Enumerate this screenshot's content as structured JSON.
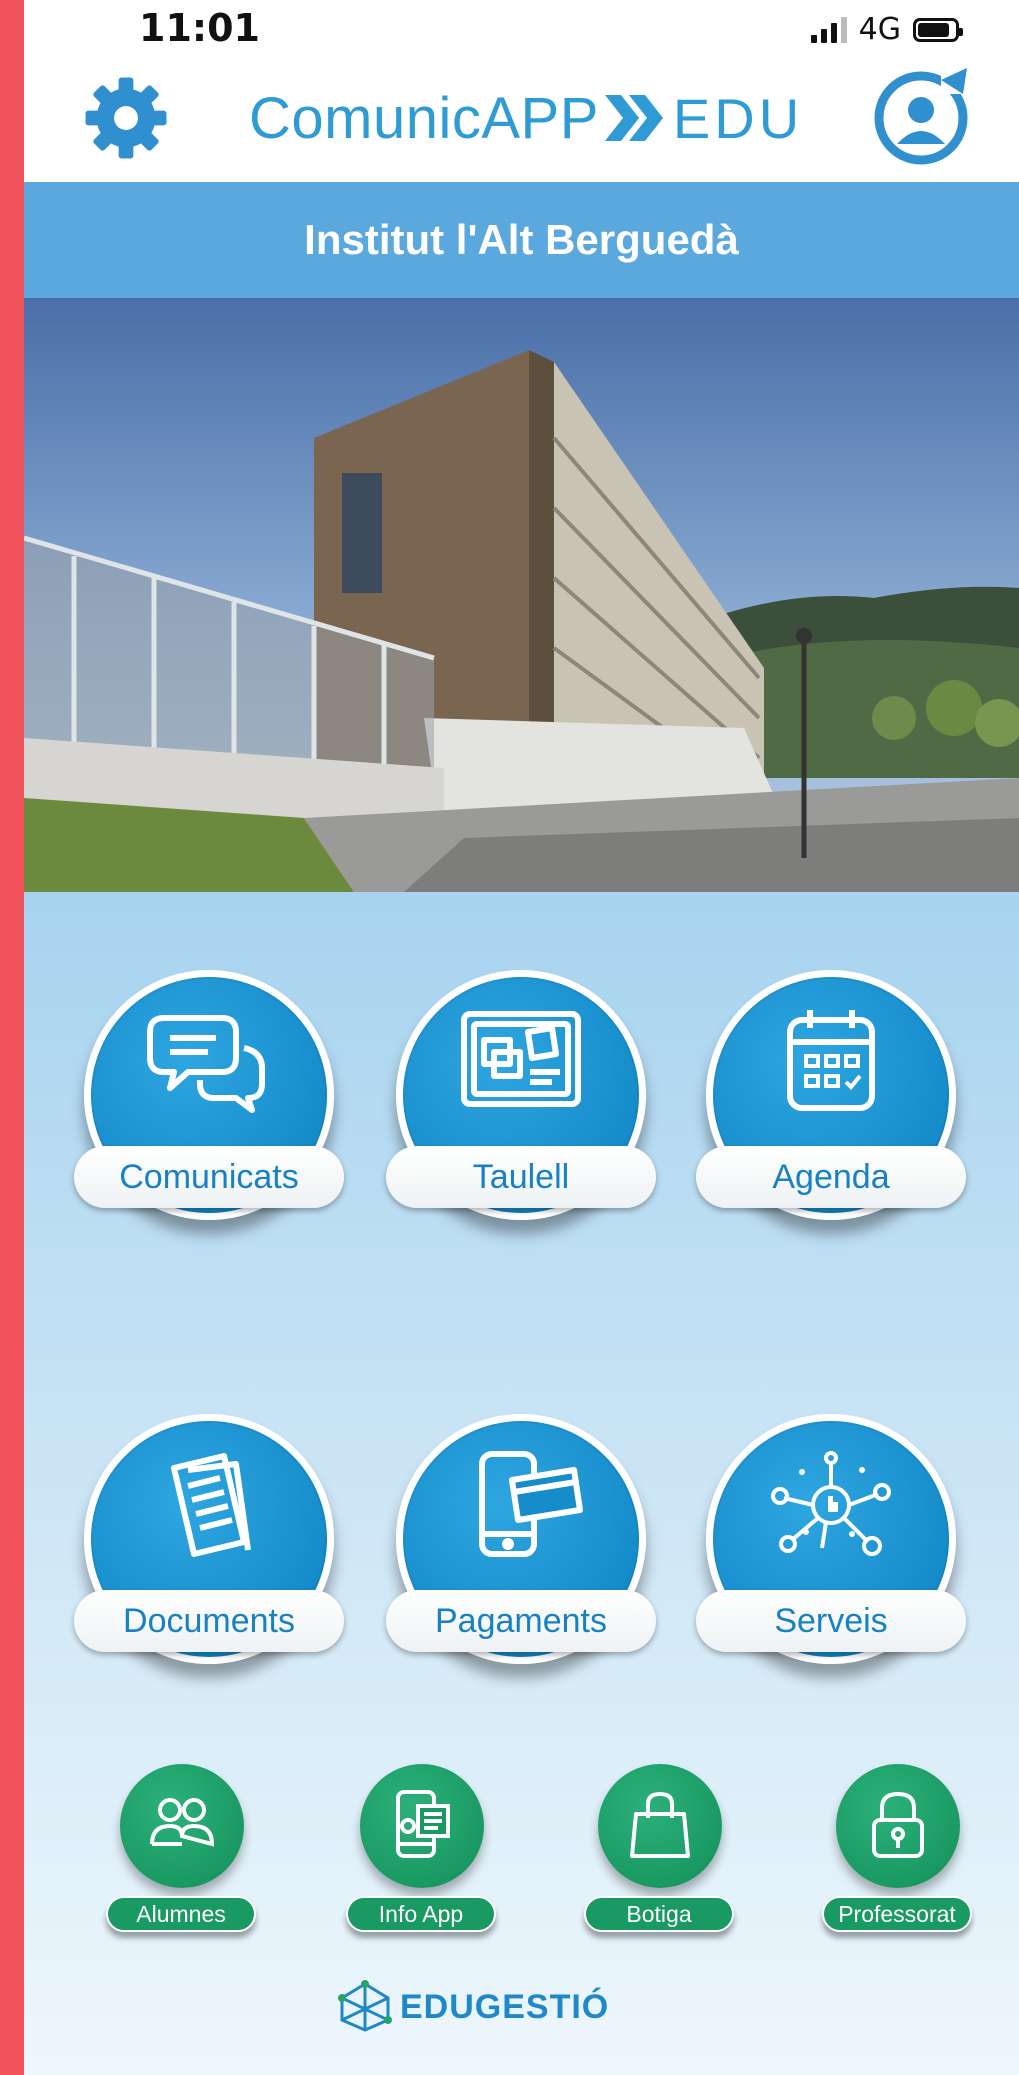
{
  "status_bar": {
    "time": "11:01",
    "network": "4G",
    "battery_level": 0.85
  },
  "header": {
    "settings_icon": "gear-icon",
    "logo_text": "ComunicAPP",
    "logo_suffix": "EDU",
    "profile_icon": "user-refresh-icon",
    "colors": {
      "brand_blue": "#2f9bd4",
      "title_bar": "#5aa8dd"
    }
  },
  "school": {
    "name": "Institut l'Alt Berguedà",
    "photo": "school-building-photo"
  },
  "main_tiles": [
    {
      "label": "Comunicats",
      "icon": "chat-bubbles-icon"
    },
    {
      "label": "Taulell",
      "icon": "notice-board-icon"
    },
    {
      "label": "Agenda",
      "icon": "calendar-icon"
    },
    {
      "label": "Documents",
      "icon": "documents-icon"
    },
    {
      "label": "Pagaments",
      "icon": "phone-card-icon"
    },
    {
      "label": "Serveis",
      "icon": "network-services-icon"
    }
  ],
  "secondary_tiles": [
    {
      "label": "Alumnes",
      "icon": "people-icon"
    },
    {
      "label": "Info App",
      "icon": "app-info-icon"
    },
    {
      "label": "Botiga",
      "icon": "shopping-bag-icon"
    },
    {
      "label": "Professorat",
      "icon": "padlock-icon"
    }
  ],
  "footer": {
    "brand": "EDUGESTIÓ"
  },
  "colors": {
    "tile_blue": "#168ccb",
    "tile_green": "#1a9a63",
    "accent_red": "#f0535b"
  }
}
